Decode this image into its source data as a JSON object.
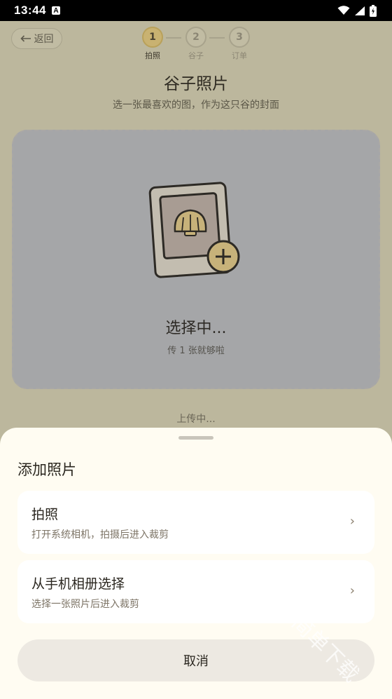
{
  "status_bar": {
    "time": "13:44",
    "notification_icon": "A"
  },
  "header": {
    "back_label": "返回",
    "steps": [
      {
        "number": "1",
        "label": "拍照",
        "active": true
      },
      {
        "number": "2",
        "label": "谷子",
        "active": false
      },
      {
        "number": "3",
        "label": "订单",
        "active": false
      }
    ]
  },
  "page": {
    "title": "谷子照片",
    "subtitle": "选一张最喜欢的图，作为这只谷的封面"
  },
  "upload_card": {
    "main_text": "选择中...",
    "sub_text": "传 1 张就够啦",
    "icon": "photo-frame-shell-plus-icon"
  },
  "status_text": "上传中...",
  "sheet": {
    "title": "添加照片",
    "options": [
      {
        "title": "拍照",
        "description": "打开系统相机，拍摄后进入裁剪",
        "chevron": "›"
      },
      {
        "title": "从手机相册选择",
        "description": "选择一张照片后进入裁剪",
        "chevron": "›"
      }
    ],
    "cancel_label": "取消"
  },
  "watermark_text": "简单下载",
  "colors": {
    "sheet_background": "#fffcf2",
    "accent_step": "#c9b271",
    "scrim_background": "#bcb79d"
  }
}
